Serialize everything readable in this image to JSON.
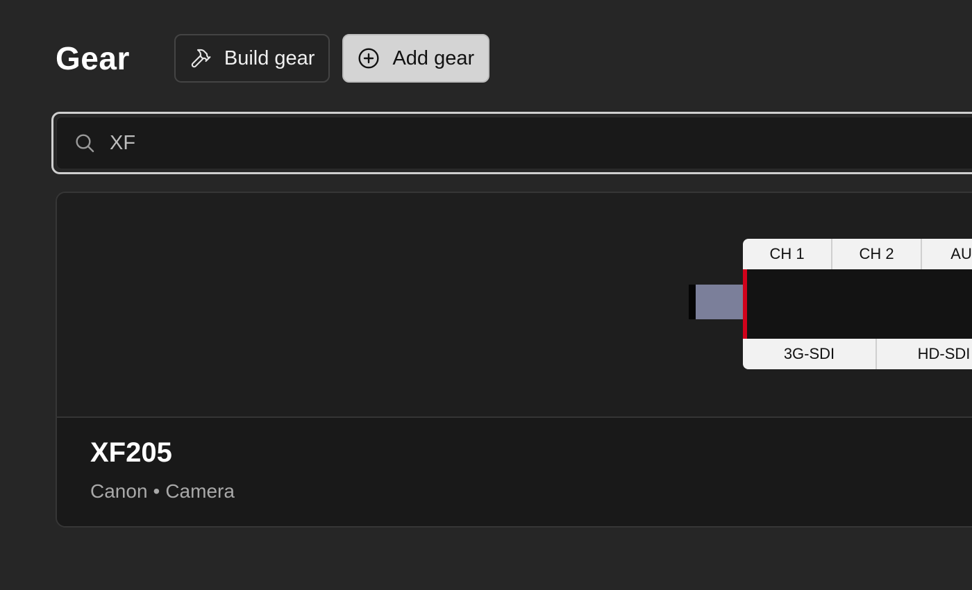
{
  "header": {
    "title": "Gear",
    "build_label": "Build gear",
    "add_label": "Add gear"
  },
  "search": {
    "value": "XF",
    "placeholder": ""
  },
  "results": [
    {
      "name": "XF205",
      "brand": "Canon",
      "separator": "•",
      "category": "Camera",
      "device": {
        "top_ports": [
          "CH 1",
          "CH 2",
          "AUD"
        ],
        "bottom_ports": [
          "3G-SDI",
          "HD-SDI"
        ],
        "colors": {
          "accent": "#d0021b",
          "connector": "#7b7f9a",
          "body": "#131313"
        }
      }
    }
  ],
  "icons": {
    "build": "hammer-icon",
    "add": "plus-circle-icon",
    "search": "search-icon"
  }
}
